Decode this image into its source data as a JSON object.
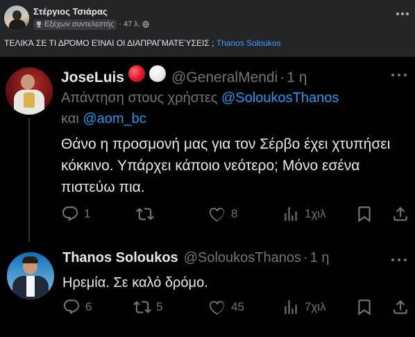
{
  "post": {
    "author": "Στέργιος Τσιάρας",
    "badge": "Εξέχων συντελεστής",
    "time": "47 λ.",
    "dot": "·",
    "text": "ΤΕΛΙΚΆ ΣΕ ΤΙ ΔΡΌΜΟ ΕΊΝΑΙ ΟΙ ΔΙΑΠΡΑΓΜΑΤΕΎΣΕΙΣ ;",
    "mention": "Thanos Soloukos"
  },
  "tweet1": {
    "name": "JoseLuis",
    "handle": "@GeneralMendi",
    "sep": "·",
    "time": "1 η",
    "reply_prefix": "Απάντηση στους χρήστες",
    "reply_user1": "@SoloukosThanos",
    "reply_and": "και",
    "reply_user2": "@aom_bc",
    "text": "Θάνο η προσμονή μας για τον Σέρβο έχει χτυπήσει κόκκινο. Υπάρχει κάποιο νεότερο; Μόνο εσένα πιστεύω πια.",
    "replies": "1",
    "retweets": "",
    "likes": "8",
    "views": "1χιλ"
  },
  "tweet2": {
    "name": "Thanos Soloukos",
    "handle": "@SoloukosThanos",
    "sep": "·",
    "time": "1 η",
    "text": "Ηρεμία. Σε καλό δρόμο.",
    "replies": "6",
    "retweets": "5",
    "likes": "45",
    "views": "7χιλ"
  },
  "colors": {
    "fb_bg": "#242526",
    "fb_mention": "#4599ff",
    "x_bg": "#000000",
    "x_link": "#1d9bf0",
    "x_muted": "#71767b"
  }
}
